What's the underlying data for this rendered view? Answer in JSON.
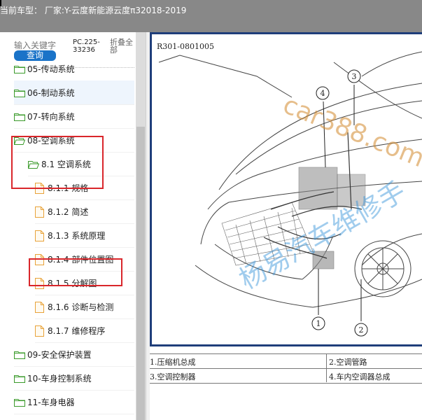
{
  "header": {
    "title": "当前车型：  厂家:Y-云度新能源云度π32018-2019"
  },
  "search": {
    "placeholder": "输入关键字",
    "button_label": "查询",
    "model_code": "PC.225-33236",
    "collapse_all": "折叠全部"
  },
  "tree": {
    "items": [
      {
        "label": "05-传动系统",
        "type": "folder"
      },
      {
        "label": "06-制动系统",
        "type": "folder"
      },
      {
        "label": "07-转向系统",
        "type": "folder"
      },
      {
        "label": "08-空调系统",
        "type": "folder-open"
      },
      {
        "label": "8.1 空调系统",
        "type": "folder-open"
      },
      {
        "label": "8.1.1 规格",
        "type": "doc"
      },
      {
        "label": "8.1.2 简述",
        "type": "doc"
      },
      {
        "label": "8.1.3 系统原理",
        "type": "doc"
      },
      {
        "label": "8.1.4 部件位置图",
        "type": "doc"
      },
      {
        "label": "8.1.5 分解图",
        "type": "doc"
      },
      {
        "label": "8.1.6 诊断与检测",
        "type": "doc"
      },
      {
        "label": "8.1.7 维修程序",
        "type": "doc"
      },
      {
        "label": "09-安全保护装置",
        "type": "folder"
      },
      {
        "label": "10-车身控制系统",
        "type": "folder"
      },
      {
        "label": "11-车身电器",
        "type": "folder"
      }
    ]
  },
  "figure": {
    "code": "R301-0801005",
    "watermark_top": "car388.com",
    "watermark_bottom": "杨易汽车维修手",
    "callouts": [
      "1",
      "2",
      "3",
      "4"
    ]
  },
  "legend": {
    "rows": [
      [
        "1.压缩机总成",
        "2.空调管路"
      ],
      [
        "3.空调控制器",
        "4.车内空调器总成"
      ]
    ]
  },
  "colors": {
    "highlight": "#d9262b",
    "folder_green": "#3a9a2a",
    "doc_orange": "#e8a33a",
    "button_blue": "#1a73c8"
  }
}
